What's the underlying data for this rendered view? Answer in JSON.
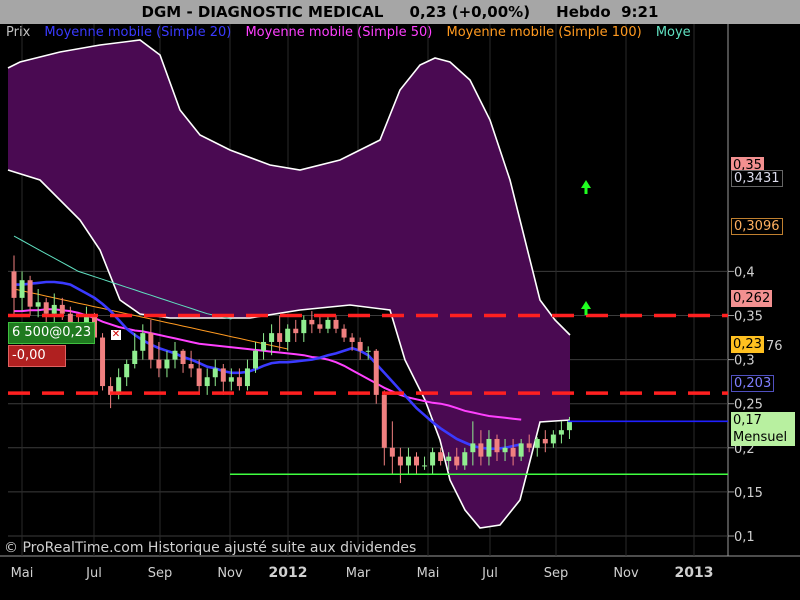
{
  "header": {
    "title": "DGM - DIAGNOSTIC MEDICAL     0,23 (+0,00%)     Hebdo  9:21"
  },
  "legend": {
    "items": [
      {
        "label": "Prix",
        "color": "#c0c0c0"
      },
      {
        "label": "Moyenne mobile (Simple 20)",
        "color": "#3a3aff"
      },
      {
        "label": "Moyenne mobile (Simple 50)",
        "color": "#ff40ff"
      },
      {
        "label": "Moyenne mobile (Simple 100)",
        "color": "#ff9a20"
      },
      {
        "label": "Moye",
        "color": "#60e0c0"
      }
    ]
  },
  "position": {
    "label": "6 500@0,23",
    "pnl": "-0,00"
  },
  "price_tags": {
    "t1": "0,35",
    "t1b": "0,3431",
    "t2": "0,3096",
    "t3": "0,262",
    "t4": "0,23",
    "t4b": "76",
    "t5": "0,203",
    "t6a": "0,17",
    "t6b": "Mensuel"
  },
  "copyright": "© ProRealTime.com Historique ajusté suite aux dividendes",
  "colors": {
    "background": "#000000",
    "band_fill": "#4a0a52",
    "up": "#90ee90",
    "down": "#f08080",
    "sma20": "#3a3aff",
    "sma50": "#ff40ff",
    "sma100": "#ff9a20",
    "sma200": "#60e0c0",
    "resistance": "#ff2020",
    "support": "#40ff40",
    "arrow": "#20ff20"
  },
  "chart_data": {
    "type": "candlestick",
    "timeframe": "Hebdo",
    "ylim": [
      0.095,
      0.44
    ],
    "y_ticks": [
      "0,4",
      "0,35",
      "0,3",
      "0,25",
      "0,2",
      "0,15",
      "0,1"
    ],
    "x_ticks": [
      "Mai",
      "Jul",
      "Sep",
      "Nov",
      "2012",
      "Mar",
      "Mai",
      "Jul",
      "Sep",
      "Nov",
      "2013"
    ],
    "horizontal_lines": [
      {
        "value": 0.35,
        "style": "dashed",
        "label": "0,35"
      },
      {
        "value": 0.262,
        "style": "dashed",
        "label": "0,262"
      },
      {
        "value": 0.17,
        "style": "solid",
        "label": "0,17 Mensuel"
      }
    ],
    "last_price": 0.23,
    "candles": [
      {
        "o": 0.4,
        "h": 0.418,
        "l": 0.35,
        "c": 0.37
      },
      {
        "o": 0.37,
        "h": 0.4,
        "l": 0.355,
        "c": 0.39
      },
      {
        "o": 0.39,
        "h": 0.395,
        "l": 0.35,
        "c": 0.36
      },
      {
        "o": 0.36,
        "h": 0.38,
        "l": 0.348,
        "c": 0.365
      },
      {
        "o": 0.365,
        "h": 0.37,
        "l": 0.34,
        "c": 0.352
      },
      {
        "o": 0.352,
        "h": 0.375,
        "l": 0.34,
        "c": 0.362
      },
      {
        "o": 0.362,
        "h": 0.37,
        "l": 0.345,
        "c": 0.352
      },
      {
        "o": 0.352,
        "h": 0.36,
        "l": 0.33,
        "c": 0.34
      },
      {
        "o": 0.34,
        "h": 0.35,
        "l": 0.318,
        "c": 0.33
      },
      {
        "o": 0.33,
        "h": 0.36,
        "l": 0.32,
        "c": 0.35
      },
      {
        "o": 0.35,
        "h": 0.353,
        "l": 0.32,
        "c": 0.325
      },
      {
        "o": 0.325,
        "h": 0.33,
        "l": 0.265,
        "c": 0.27
      },
      {
        "o": 0.27,
        "h": 0.28,
        "l": 0.245,
        "c": 0.26
      },
      {
        "o": 0.26,
        "h": 0.29,
        "l": 0.255,
        "c": 0.28
      },
      {
        "o": 0.28,
        "h": 0.3,
        "l": 0.27,
        "c": 0.295
      },
      {
        "o": 0.295,
        "h": 0.33,
        "l": 0.29,
        "c": 0.31
      },
      {
        "o": 0.31,
        "h": 0.34,
        "l": 0.3,
        "c": 0.33
      },
      {
        "o": 0.33,
        "h": 0.345,
        "l": 0.29,
        "c": 0.3
      },
      {
        "o": 0.3,
        "h": 0.32,
        "l": 0.28,
        "c": 0.29
      },
      {
        "o": 0.29,
        "h": 0.31,
        "l": 0.28,
        "c": 0.3
      },
      {
        "o": 0.3,
        "h": 0.32,
        "l": 0.29,
        "c": 0.31
      },
      {
        "o": 0.31,
        "h": 0.312,
        "l": 0.285,
        "c": 0.295
      },
      {
        "o": 0.295,
        "h": 0.31,
        "l": 0.28,
        "c": 0.29
      },
      {
        "o": 0.29,
        "h": 0.3,
        "l": 0.26,
        "c": 0.27
      },
      {
        "o": 0.27,
        "h": 0.29,
        "l": 0.26,
        "c": 0.28
      },
      {
        "o": 0.28,
        "h": 0.3,
        "l": 0.27,
        "c": 0.29
      },
      {
        "o": 0.29,
        "h": 0.295,
        "l": 0.26,
        "c": 0.275
      },
      {
        "o": 0.275,
        "h": 0.29,
        "l": 0.265,
        "c": 0.28
      },
      {
        "o": 0.28,
        "h": 0.29,
        "l": 0.265,
        "c": 0.27
      },
      {
        "o": 0.27,
        "h": 0.3,
        "l": 0.265,
        "c": 0.29
      },
      {
        "o": 0.29,
        "h": 0.32,
        "l": 0.285,
        "c": 0.31
      },
      {
        "o": 0.31,
        "h": 0.33,
        "l": 0.3,
        "c": 0.32
      },
      {
        "o": 0.32,
        "h": 0.34,
        "l": 0.305,
        "c": 0.33
      },
      {
        "o": 0.33,
        "h": 0.35,
        "l": 0.31,
        "c": 0.32
      },
      {
        "o": 0.32,
        "h": 0.34,
        "l": 0.31,
        "c": 0.335
      },
      {
        "o": 0.335,
        "h": 0.345,
        "l": 0.32,
        "c": 0.33
      },
      {
        "o": 0.33,
        "h": 0.35,
        "l": 0.32,
        "c": 0.345
      },
      {
        "o": 0.345,
        "h": 0.355,
        "l": 0.33,
        "c": 0.34
      },
      {
        "o": 0.34,
        "h": 0.35,
        "l": 0.33,
        "c": 0.335
      },
      {
        "o": 0.335,
        "h": 0.35,
        "l": 0.33,
        "c": 0.345
      },
      {
        "o": 0.345,
        "h": 0.35,
        "l": 0.33,
        "c": 0.335
      },
      {
        "o": 0.335,
        "h": 0.34,
        "l": 0.32,
        "c": 0.325
      },
      {
        "o": 0.325,
        "h": 0.33,
        "l": 0.31,
        "c": 0.32
      },
      {
        "o": 0.32,
        "h": 0.325,
        "l": 0.3,
        "c": 0.31
      },
      {
        "o": 0.31,
        "h": 0.315,
        "l": 0.3,
        "c": 0.31
      },
      {
        "o": 0.31,
        "h": 0.312,
        "l": 0.25,
        "c": 0.26
      },
      {
        "o": 0.26,
        "h": 0.265,
        "l": 0.18,
        "c": 0.2
      },
      {
        "o": 0.2,
        "h": 0.23,
        "l": 0.17,
        "c": 0.19
      },
      {
        "o": 0.19,
        "h": 0.2,
        "l": 0.16,
        "c": 0.18
      },
      {
        "o": 0.18,
        "h": 0.2,
        "l": 0.17,
        "c": 0.19
      },
      {
        "o": 0.19,
        "h": 0.195,
        "l": 0.17,
        "c": 0.18
      },
      {
        "o": 0.18,
        "h": 0.19,
        "l": 0.175,
        "c": 0.18
      },
      {
        "o": 0.18,
        "h": 0.2,
        "l": 0.17,
        "c": 0.195
      },
      {
        "o": 0.195,
        "h": 0.2,
        "l": 0.18,
        "c": 0.185
      },
      {
        "o": 0.185,
        "h": 0.195,
        "l": 0.175,
        "c": 0.19
      },
      {
        "o": 0.19,
        "h": 0.2,
        "l": 0.175,
        "c": 0.18
      },
      {
        "o": 0.18,
        "h": 0.2,
        "l": 0.175,
        "c": 0.195
      },
      {
        "o": 0.195,
        "h": 0.23,
        "l": 0.18,
        "c": 0.205
      },
      {
        "o": 0.205,
        "h": 0.22,
        "l": 0.18,
        "c": 0.19
      },
      {
        "o": 0.19,
        "h": 0.22,
        "l": 0.18,
        "c": 0.21
      },
      {
        "o": 0.21,
        "h": 0.215,
        "l": 0.185,
        "c": 0.195
      },
      {
        "o": 0.195,
        "h": 0.21,
        "l": 0.185,
        "c": 0.2
      },
      {
        "o": 0.2,
        "h": 0.21,
        "l": 0.18,
        "c": 0.19
      },
      {
        "o": 0.19,
        "h": 0.21,
        "l": 0.185,
        "c": 0.205
      },
      {
        "o": 0.205,
        "h": 0.215,
        "l": 0.195,
        "c": 0.2
      },
      {
        "o": 0.2,
        "h": 0.212,
        "l": 0.19,
        "c": 0.21
      },
      {
        "o": 0.21,
        "h": 0.22,
        "l": 0.195,
        "c": 0.205
      },
      {
        "o": 0.205,
        "h": 0.22,
        "l": 0.2,
        "c": 0.215
      },
      {
        "o": 0.215,
        "h": 0.23,
        "l": 0.205,
        "c": 0.22
      },
      {
        "o": 0.22,
        "h": 0.235,
        "l": 0.21,
        "c": 0.23
      }
    ],
    "sma20": [
      0.385,
      0.385,
      0.386,
      0.387,
      0.388,
      0.388,
      0.387,
      0.385,
      0.38,
      0.375,
      0.37,
      0.363,
      0.355,
      0.345,
      0.335,
      0.328,
      0.322,
      0.317,
      0.313,
      0.31,
      0.307,
      0.303,
      0.3,
      0.296,
      0.292,
      0.29,
      0.287,
      0.285,
      0.285,
      0.286,
      0.289,
      0.293,
      0.296,
      0.297,
      0.297,
      0.298,
      0.299,
      0.3,
      0.302,
      0.305,
      0.307,
      0.31,
      0.313,
      0.31,
      0.305,
      0.295,
      0.285,
      0.275,
      0.265,
      0.255,
      0.245,
      0.237,
      0.229,
      0.222,
      0.216,
      0.21,
      0.206,
      0.202,
      0.2,
      0.199,
      0.199,
      0.2,
      0.202,
      0.204
    ],
    "sma50": [
      0.355,
      0.355,
      0.356,
      0.356,
      0.357,
      0.357,
      0.356,
      0.355,
      0.353,
      0.35,
      0.347,
      0.343,
      0.34,
      0.337,
      0.335,
      0.333,
      0.332,
      0.33,
      0.328,
      0.326,
      0.324,
      0.322,
      0.32,
      0.318,
      0.317,
      0.316,
      0.315,
      0.314,
      0.313,
      0.312,
      0.311,
      0.31,
      0.309,
      0.308,
      0.307,
      0.306,
      0.305,
      0.303,
      0.302,
      0.3,
      0.297,
      0.293,
      0.288,
      0.283,
      0.278,
      0.273,
      0.268,
      0.264,
      0.26,
      0.257,
      0.255,
      0.253,
      0.251,
      0.25,
      0.248,
      0.245,
      0.242,
      0.24,
      0.238,
      0.236,
      0.235,
      0.234,
      0.233,
      0.232
    ],
    "sma100": [
      0.38,
      0.378,
      0.376,
      0.374,
      0.372,
      0.37,
      0.368,
      0.366,
      0.364,
      0.362,
      0.36,
      0.358,
      0.356,
      0.354,
      0.352,
      0.35,
      0.348,
      0.346,
      0.344,
      0.342,
      0.34,
      0.338,
      0.336,
      0.334,
      0.332,
      0.33,
      0.328,
      0.326,
      0.324,
      0.322,
      0.32,
      0.318,
      0.316,
      0.314,
      0.312
    ],
    "sma200": [
      0.44,
      0.435,
      0.43,
      0.425,
      0.42,
      0.415,
      0.41,
      0.405,
      0.4,
      0.397,
      0.394,
      0.391,
      0.388,
      0.385,
      0.382,
      0.379,
      0.376,
      0.373,
      0.37,
      0.367,
      0.364,
      0.361,
      0.358,
      0.355,
      0.352,
      0.35,
      0.348,
      0.346
    ]
  }
}
